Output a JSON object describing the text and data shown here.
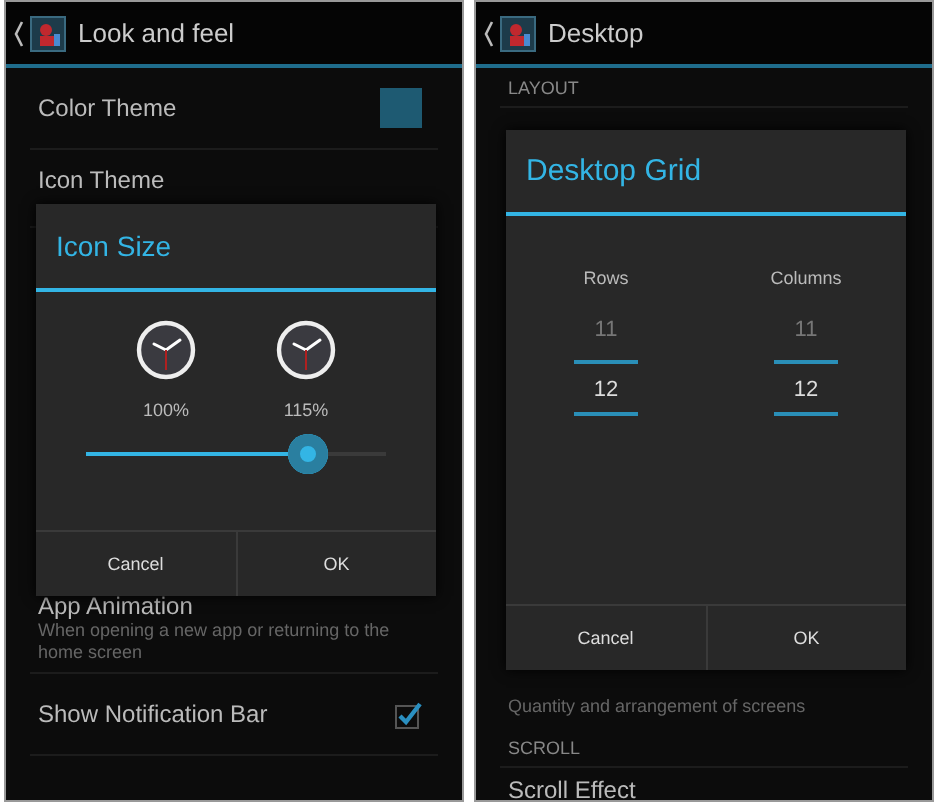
{
  "screens": [
    {
      "title": "Look and feel",
      "items": [
        {
          "kind": "swatch",
          "label": "Color Theme",
          "color": "#1e5a72"
        },
        {
          "kind": "plain",
          "label": "Icon Theme"
        },
        {
          "kind": "plain",
          "label": "App Animation",
          "summary": "When opening a new app or returning to the home screen"
        },
        {
          "kind": "checkbox",
          "label": "Show Notification Bar",
          "checked": true
        }
      ],
      "dialog": {
        "kind": "slider",
        "title": "Icon Size",
        "previews": [
          {
            "label": "100%"
          },
          {
            "label": "115%"
          }
        ],
        "level": 0.74,
        "buttons": [
          "Cancel",
          "OK"
        ]
      }
    },
    {
      "title": "Desktop",
      "items": [
        {
          "kind": "header",
          "label": "LAYOUT"
        },
        {
          "kind": "note",
          "label": "Quantity and arrangement of screens"
        },
        {
          "kind": "header",
          "label": "SCROLL"
        },
        {
          "kind": "plain",
          "label": "Scroll Effect"
        }
      ],
      "dialog": {
        "kind": "pickers",
        "title": "Desktop Grid",
        "columns": [
          {
            "label": "Rows",
            "previous": "11",
            "value": "12"
          },
          {
            "label": "Columns",
            "previous": "11",
            "value": "12"
          }
        ],
        "buttons": [
          "Cancel",
          "OK"
        ]
      }
    }
  ]
}
